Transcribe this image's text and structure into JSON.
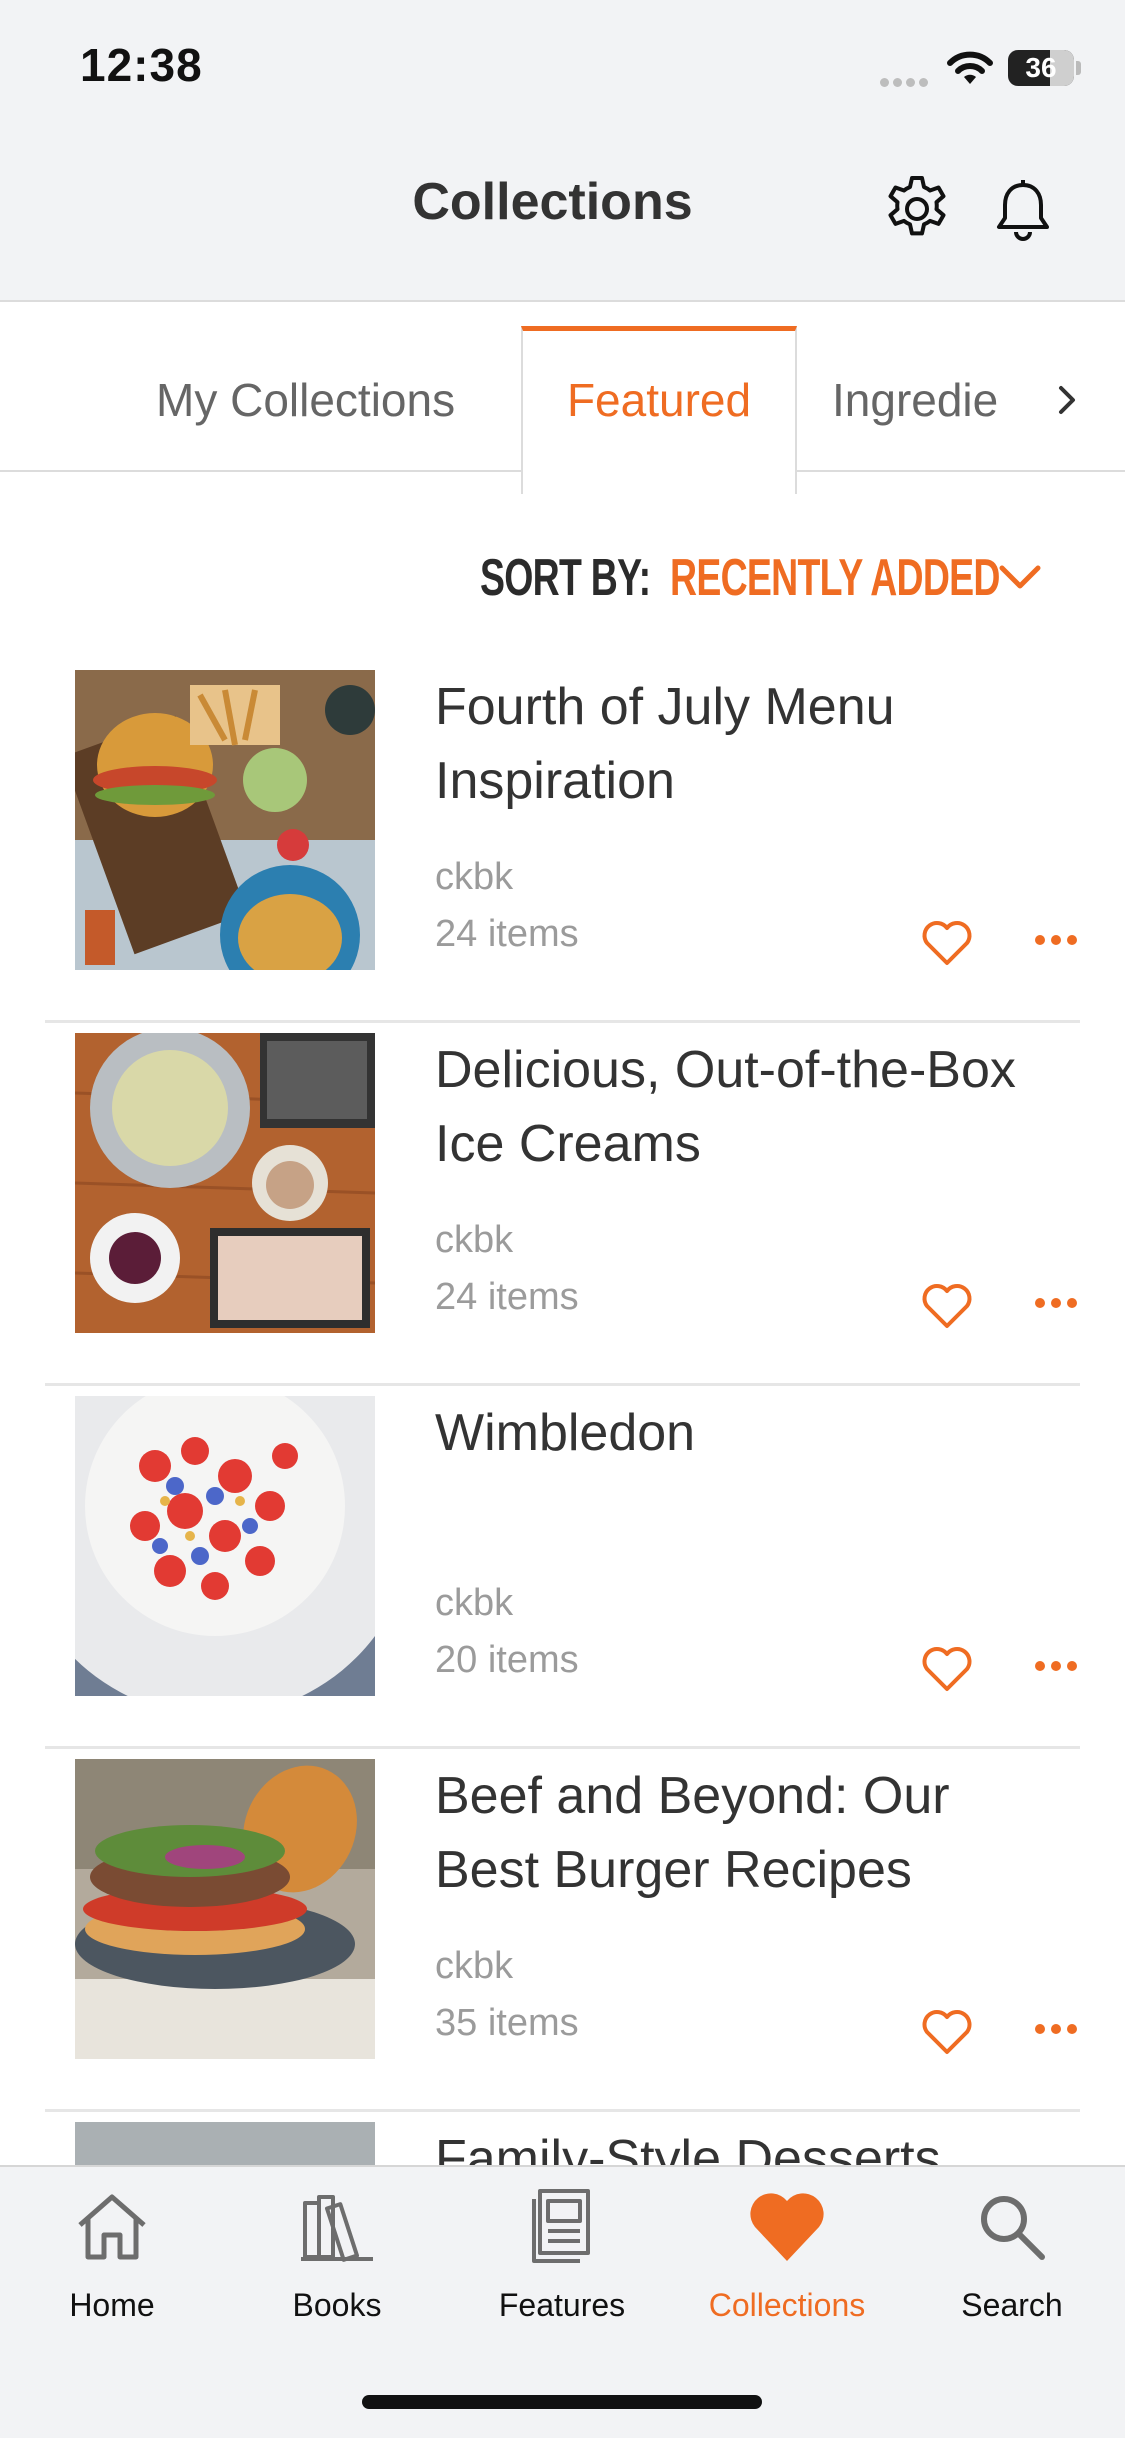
{
  "status_bar": {
    "time": "12:38",
    "battery": "36"
  },
  "header": {
    "title": "Collections",
    "settings_icon": "gear-icon",
    "notifications_icon": "bell-icon"
  },
  "tabs": {
    "items": [
      {
        "label": "My Collections",
        "active": false
      },
      {
        "label": "Featured",
        "active": true
      },
      {
        "label": "Ingredie",
        "active": false
      }
    ],
    "scroll_icon": "chevron-right-icon"
  },
  "sort": {
    "label": "SORT BY:",
    "value": "RECENTLY ADDED"
  },
  "collections": [
    {
      "title": "Fourth of July Menu Inspiration",
      "author": "ckbk",
      "count": "24 items",
      "image": "burgers-and-fries-photo"
    },
    {
      "title": "Delicious, Out-of-the-Box Ice Creams",
      "author": "ckbk",
      "count": "24 items",
      "image": "ice-cream-maker-photo"
    },
    {
      "title": "Wimbledon",
      "author": "ckbk",
      "count": "20 items",
      "image": "strawberry-salad-photo"
    },
    {
      "title": "Beef and Beyond: Our Best Burger Recipes",
      "author": "ckbk",
      "count": "35 items",
      "image": "burger-photo"
    },
    {
      "title": "Family-Style Desserts",
      "author": "",
      "count": "",
      "image": "dessert-photo"
    }
  ],
  "tab_bar": {
    "items": [
      {
        "label": "Home",
        "icon": "home-icon",
        "active": false
      },
      {
        "label": "Books",
        "icon": "books-icon",
        "active": false
      },
      {
        "label": "Features",
        "icon": "features-icon",
        "active": false
      },
      {
        "label": "Collections",
        "icon": "heart-icon",
        "active": true
      },
      {
        "label": "Search",
        "icon": "search-icon",
        "active": false
      }
    ]
  },
  "colors": {
    "accent": "#ef6c22",
    "text": "#333333",
    "muted": "#9b9b9b",
    "chrome": "#f2f3f5"
  }
}
